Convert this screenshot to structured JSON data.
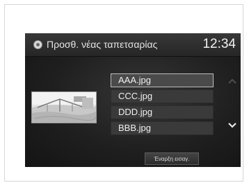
{
  "header": {
    "title": "Προσθ. νέας ταπετσαρίας",
    "clock": "12:34",
    "icon": "wallpaper-icon"
  },
  "preview": {
    "icon": "image-thumbnail"
  },
  "file_list": {
    "items": [
      "AAA.jpg",
      "CCC.jpg",
      "DDD.jpg",
      "BBB.jpg"
    ],
    "selected": "AAA.jpg"
  },
  "scroll": {
    "up_icon": "chevron-up-icon",
    "down_icon": "chevron-down-icon"
  },
  "actions": {
    "start_label": "Έναρξη εισαγ."
  },
  "colors": {
    "screen_background": "#1f1f1f",
    "text": "#f0f0f0",
    "selection_border": "#bdbdbd"
  }
}
